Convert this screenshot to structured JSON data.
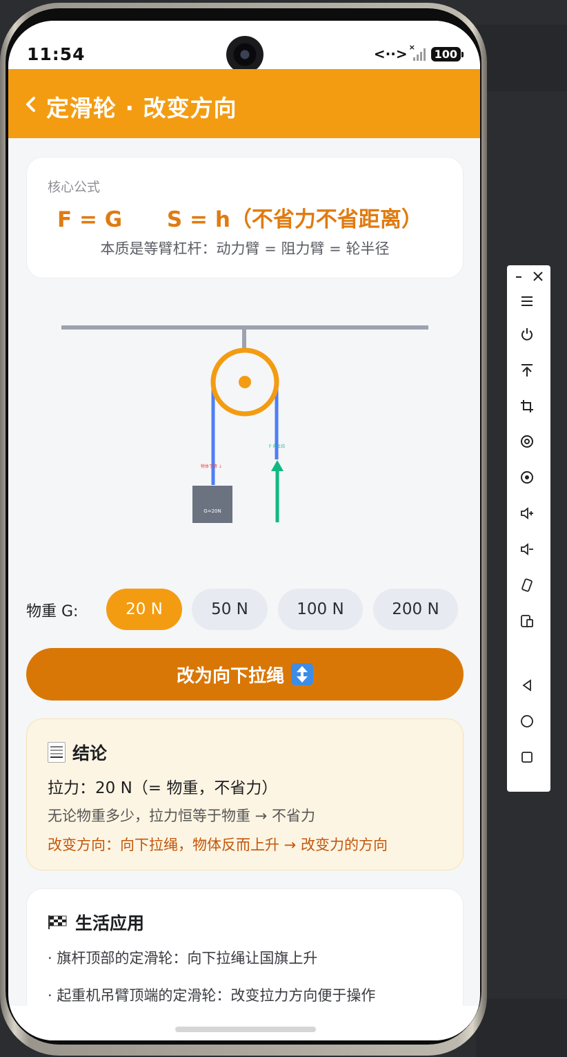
{
  "status_bar": {
    "time": "11:54",
    "battery": "100"
  },
  "header": {
    "title": "定滑轮 · 改变方向"
  },
  "formula_card": {
    "label": "核心公式",
    "formula": "F = G      S = h（不省力不省距离）",
    "note": "本质是等臂杠杆：动力臂 = 阻力臂 = 轮半径"
  },
  "diagram": {
    "object_label": "物体下降 ↓",
    "weight_label": "G=20N",
    "force_label": "F 向上拉",
    "colors": {
      "pulley": "#f39c12",
      "rope": "#4f7ef5",
      "arrow": "#10b981",
      "block": "#6b7280",
      "beam": "#9ca3af"
    }
  },
  "weight_selector": {
    "label": "物重 G:",
    "options": [
      "20 N",
      "50 N",
      "100 N",
      "200 N"
    ],
    "selected": "20 N"
  },
  "toggle_button": {
    "label": "改为向下拉绳"
  },
  "conclusion": {
    "title": "结论",
    "line1": "拉力：20 N（= 物重，不省力）",
    "line2": "无论物重多少，拉力恒等于物重 → 不省力",
    "line3": "改变方向：向下拉绳，物体反而上升 → 改变力的方向"
  },
  "applications": {
    "title": "生活应用",
    "items": [
      "· 旗杆顶部的定滑轮：向下拉绳让国旗上升",
      "· 起重机吊臂顶端的定滑轮：改变拉力方向便于操作"
    ]
  },
  "toolbar": {
    "items": [
      "minimize",
      "close",
      "menu",
      "power",
      "to-top",
      "crop",
      "screenshot",
      "record",
      "volume-up",
      "volume-down",
      "rotate",
      "multi-screen",
      "back",
      "home",
      "recent"
    ]
  },
  "theme": {
    "accent": "#f39c12",
    "button": "#d97706"
  }
}
